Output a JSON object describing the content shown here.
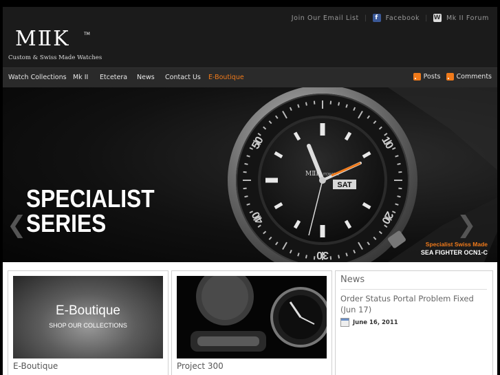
{
  "brand": {
    "logo_mark": "MⅡK",
    "tm": "TM",
    "tagline": "Custom & Swiss Made Watches"
  },
  "top_links": {
    "email": "Join Our Email List",
    "facebook": "Facebook",
    "facebook_icon": "facebook-icon",
    "forum": "Mk II Forum",
    "forum_icon": "wiki-w-icon"
  },
  "nav": {
    "items": [
      "Watch Collections",
      "Mk II",
      "Etcetera",
      "News",
      "Contact Us",
      "E-Boutique"
    ],
    "active": "E-Boutique"
  },
  "feeds": {
    "posts": "Posts",
    "comments": "Comments"
  },
  "hero": {
    "title_line1": "SPECIALIST",
    "title_line2": "SERIES",
    "caption_line1": "Specialist Swiss Made",
    "caption_line2": "SEA FIGHTER OCN1-C",
    "dial_day": "SAT",
    "dial_brand": "MⅡK",
    "dial_auto": "AUTOMATIC",
    "bezel_numbers": [
      "10",
      "20",
      "30",
      "40",
      "50"
    ]
  },
  "cards": [
    {
      "label": "E-Boutique",
      "image_title": "E-Boutique",
      "image_subtitle": "SHOP OUR COLLECTIONS"
    },
    {
      "label": "Project 300"
    }
  ],
  "news": {
    "heading": "News",
    "post_title": "Order Status Portal Problem Fixed (Jun 17)",
    "post_date": "June 16, 2011"
  },
  "colors": {
    "accent": "#f07a1a",
    "nav_bg": "#2a2a2a",
    "header_bg": "#1b1b1b"
  }
}
